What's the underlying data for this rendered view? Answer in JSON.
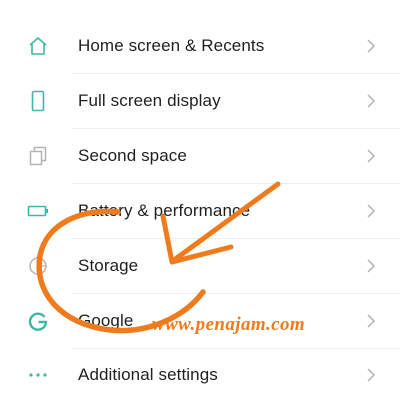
{
  "colors": {
    "icon_teal": "#3bb8a8",
    "annotation_orange": "#f07b1c",
    "text": "#1f1f1f",
    "chevron": "#b4b4b4",
    "divider": "#eeeeee"
  },
  "settings": {
    "items": [
      {
        "label": "Home screen & Recents",
        "icon": "home-icon"
      },
      {
        "label": "Full screen display",
        "icon": "phone-icon"
      },
      {
        "label": "Second space",
        "icon": "copy-icon"
      },
      {
        "label": "Battery & performance",
        "icon": "battery-icon"
      },
      {
        "label": "Storage",
        "icon": "storage-icon"
      },
      {
        "label": "Google",
        "icon": "google-icon"
      },
      {
        "label": "Additional settings",
        "icon": "more-icon"
      }
    ]
  },
  "watermark": {
    "text": "www.penajam.com"
  }
}
